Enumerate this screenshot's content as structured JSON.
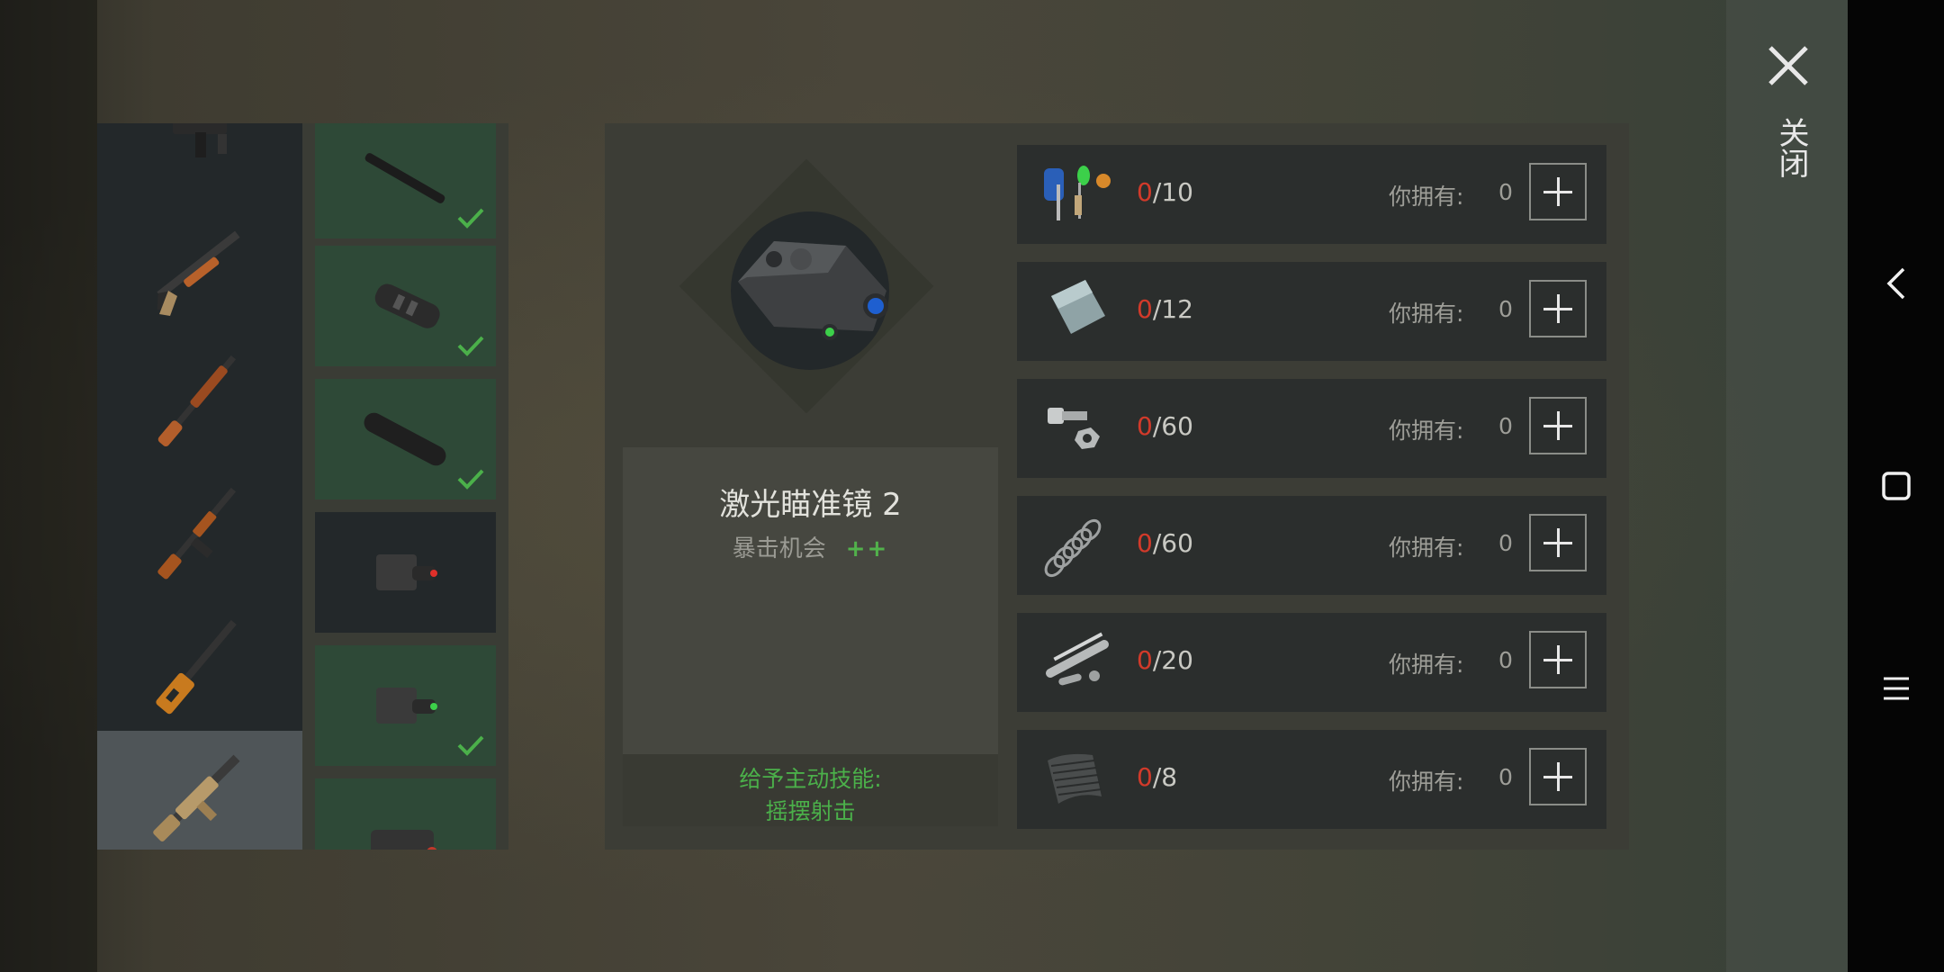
{
  "close": {
    "label": "关闭",
    "icon": "close-icon"
  },
  "weapons": [
    {
      "name": "smg",
      "icon": "smg-icon"
    },
    {
      "name": "pump-shotgun",
      "icon": "shotgun-icon"
    },
    {
      "name": "lever-rifle",
      "icon": "lever-rifle-icon"
    },
    {
      "name": "ak-rifle",
      "icon": "ak-rifle-icon"
    },
    {
      "name": "vss-rifle",
      "icon": "vss-rifle-icon"
    },
    {
      "name": "scar-rifle",
      "icon": "scar-rifle-icon",
      "selected": true
    }
  ],
  "attachments": [
    {
      "icon": "barrel-icon",
      "owned": true
    },
    {
      "icon": "compensator-icon",
      "owned": true
    },
    {
      "icon": "suppressor-icon",
      "owned": true
    },
    {
      "icon": "laser-red-icon",
      "owned": false
    },
    {
      "icon": "laser-green-icon",
      "owned": true
    },
    {
      "icon": "laser-box-icon",
      "owned": true
    }
  ],
  "detail": {
    "name": "激光瞄准镜 2",
    "stat_label": "暴击机会",
    "stat_value": "++",
    "skill_line1": "给予主动技能:",
    "skill_line2": "摇摆射击"
  },
  "materials": [
    {
      "icon": "electronics-icon",
      "have": "0",
      "need": "/10",
      "own_label": "你拥有:",
      "own_value": "0"
    },
    {
      "icon": "metal-plate-icon",
      "have": "0",
      "need": "/12",
      "own_label": "你拥有:",
      "own_value": "0"
    },
    {
      "icon": "bolt-nut-icon",
      "have": "0",
      "need": "/60",
      "own_label": "你拥有:",
      "own_value": "0"
    },
    {
      "icon": "spring-icon",
      "have": "0",
      "need": "/60",
      "own_label": "你拥有:",
      "own_value": "0"
    },
    {
      "icon": "pipe-parts-icon",
      "have": "0",
      "need": "/20",
      "own_label": "你拥有:",
      "own_value": "0"
    },
    {
      "icon": "mesh-sheet-icon",
      "have": "0",
      "need": "/8",
      "own_label": "你拥有:",
      "own_value": "0"
    }
  ],
  "colors": {
    "owned_bg": "#2e4937",
    "check": "#4bb04a",
    "need_red": "#d23a2a"
  }
}
